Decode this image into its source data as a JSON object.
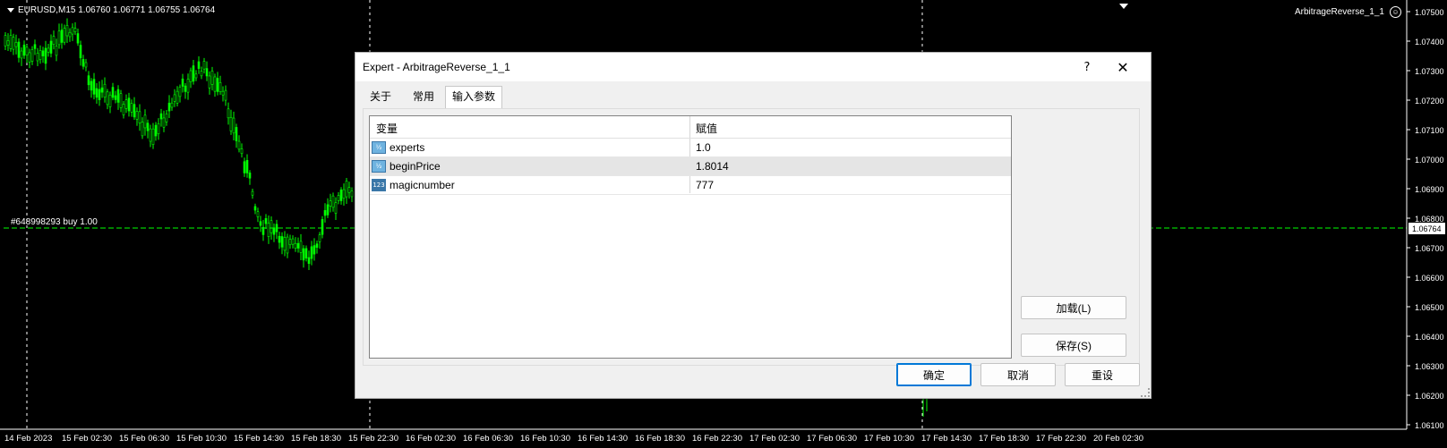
{
  "chart": {
    "header": "EURUSD,M15  1.06760 1.06771 1.06755 1.06764",
    "ea_name": "ArbitrageReverse_1_1",
    "order_label": "#648998293 buy 1.00",
    "current_price": "1.06764",
    "price_labels": [
      "1.07500",
      "1.07400",
      "1.07300",
      "1.07200",
      "1.07100",
      "1.07000",
      "1.06900",
      "1.06800",
      "1.06700",
      "1.06600",
      "1.06500",
      "1.06400",
      "1.06300",
      "1.06200",
      "1.06100"
    ],
    "time_labels": [
      "14 Feb 2023",
      "15 Feb 02:30",
      "15 Feb 06:30",
      "15 Feb 10:30",
      "15 Feb 14:30",
      "15 Feb 18:30",
      "15 Feb 22:30",
      "16 Feb 02:30",
      "16 Feb 06:30",
      "16 Feb 10:30",
      "16 Feb 14:30",
      "16 Feb 18:30",
      "16 Feb 22:30",
      "17 Feb 02:30",
      "17 Feb 06:30",
      "17 Feb 10:30",
      "17 Feb 14:30",
      "17 Feb 18:30",
      "17 Feb 22:30",
      "20 Feb 02:30"
    ],
    "colors": {
      "background": "#000000",
      "candles": "#00ff00",
      "grid": "#ffffff",
      "price_box": "#ffffff"
    }
  },
  "dialog": {
    "title": "Expert - ArbitrageReverse_1_1",
    "help": "?",
    "close": "✕",
    "tabs": [
      "关于",
      "常用",
      "输入参数"
    ],
    "active_tab": "输入参数",
    "grid": {
      "col_variable": "变量",
      "col_value": "赋值",
      "rows": [
        {
          "icon": "double-icon",
          "icon_text": "½",
          "name": "experts",
          "value": "1.0"
        },
        {
          "icon": "double-icon",
          "icon_text": "½",
          "name": "beginPrice",
          "value": "1.8014"
        },
        {
          "icon": "integer-icon",
          "icon_text": "123",
          "name": "magicnumber",
          "value": "777"
        }
      ]
    },
    "buttons": {
      "load": "加载(L)",
      "save": "保存(S)",
      "ok": "确定",
      "cancel": "取消",
      "reset": "重设"
    }
  }
}
